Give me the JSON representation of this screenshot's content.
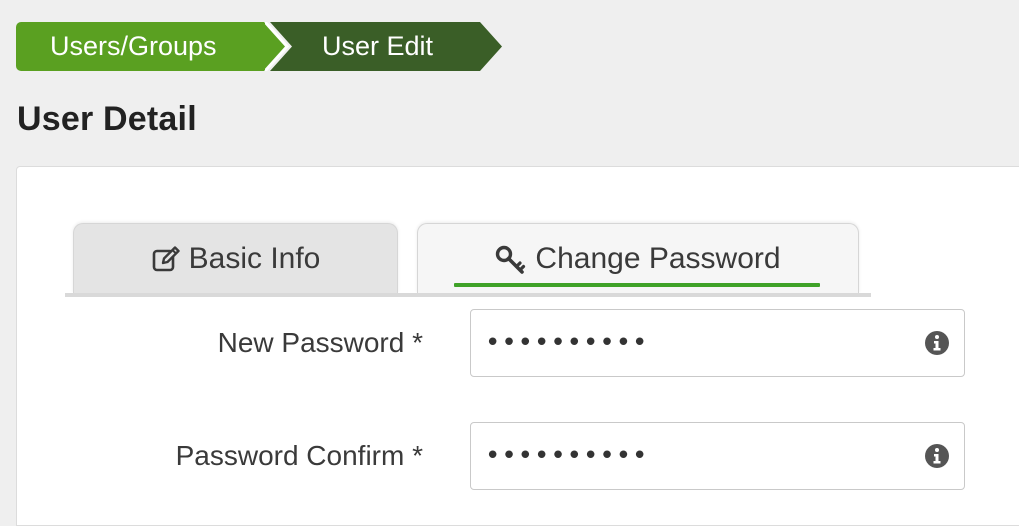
{
  "breadcrumb": {
    "items": [
      {
        "label": "Users/Groups"
      },
      {
        "label": "User Edit"
      }
    ]
  },
  "page": {
    "title": "User Detail"
  },
  "tabs": [
    {
      "label": "Basic Info",
      "icon": "edit-icon"
    },
    {
      "label": "Change Password",
      "icon": "key-icon",
      "active": true
    }
  ],
  "form": {
    "new_password": {
      "label": "New Password *",
      "value": "••••••••••",
      "icon": "info-icon"
    },
    "password_confirm": {
      "label": "Password Confirm *",
      "value": "••••••••••",
      "icon": "info-icon"
    }
  },
  "colors": {
    "breadcrumb_primary": "#5aa021",
    "breadcrumb_active": "#3a5e27",
    "tab_underline": "#3fa228",
    "background": "#efefef"
  }
}
